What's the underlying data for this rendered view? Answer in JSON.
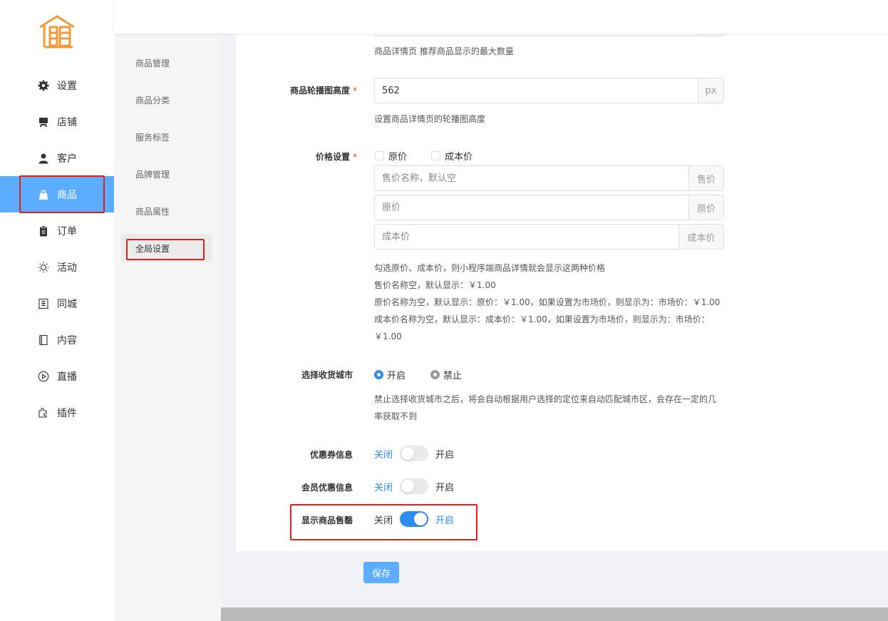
{
  "nav": {
    "items": [
      {
        "label": "设置",
        "icon": "gear-icon"
      },
      {
        "label": "店铺",
        "icon": "store-icon"
      },
      {
        "label": "客户",
        "icon": "user-icon"
      },
      {
        "label": "商品",
        "icon": "shopping-bag-icon"
      },
      {
        "label": "订单",
        "icon": "clipboard-icon"
      },
      {
        "label": "活动",
        "icon": "sun-icon"
      },
      {
        "label": "同城",
        "icon": "building-icon"
      },
      {
        "label": "内容",
        "icon": "notebook-icon"
      },
      {
        "label": "直播",
        "icon": "play-circle-icon"
      },
      {
        "label": "插件",
        "icon": "puzzle-icon"
      }
    ],
    "active": "商品"
  },
  "subnav": {
    "items": [
      "商品管理",
      "商品分类",
      "服务标签",
      "品牌管理",
      "商品属性",
      "全局设置"
    ],
    "active": "全局设置"
  },
  "form": {
    "recommend_help": "商品详情页 推荐商品显示的最大数量",
    "carousel": {
      "label": "商品轮播图高度",
      "required_mark": "*",
      "value": "562",
      "unit": "px",
      "help": "设置商品详情页的轮播图高度"
    },
    "price": {
      "label": "价格设置",
      "required_mark": "*",
      "options": [
        "原价",
        "成本价"
      ],
      "inputs": [
        {
          "placeholder": "售价名称，默认空",
          "addon": "售价"
        },
        {
          "placeholder": "原价",
          "addon": "原价"
        },
        {
          "placeholder": "成本价",
          "addon": "成本价"
        }
      ],
      "help_lines": [
        "勾选原价、成本价，则小程序端商品详情就会显示这两种价格",
        "售价名称空，默认显示：￥1.00",
        "原价名称为空，默认显示：原价：￥1.00，如果设置为市场价，则显示为：市场价：￥1.00",
        "成本价名称为空，默认显示：成本价：￥1.00，如果设置为市场价，则显示为：市场价：",
        "￥1.00"
      ]
    },
    "city": {
      "label": "选择收货城市",
      "options": [
        "开启",
        "禁止"
      ],
      "selected": "开启",
      "help_lines": [
        "禁止选择收货城市之后，将会自动根据用户选择的定位来自动匹配城市区，会存在一定的几",
        "率获取不到"
      ]
    },
    "coupon": {
      "label": "优惠券信息",
      "off": "关闭",
      "on": "开启",
      "enabled": false
    },
    "member": {
      "label": "会员优惠信息",
      "off": "关闭",
      "on": "开启",
      "enabled": false
    },
    "soldout": {
      "label": "显示商品售罄",
      "off": "关闭",
      "on": "开启",
      "enabled": true
    }
  },
  "actions": {
    "save": "保存"
  },
  "colors": {
    "primary": "#2d8cf0",
    "active_nav": "#5cadff",
    "highlight": "#e0201c",
    "logo": "#f29a38"
  }
}
